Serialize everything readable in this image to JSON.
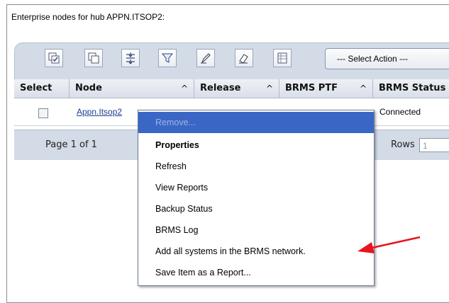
{
  "heading": "Enterprise nodes for hub APPN.ITSOP2:",
  "toolbar": {
    "buttons": [
      {
        "name": "select-all-icon"
      },
      {
        "name": "deselect-all-icon"
      },
      {
        "name": "expand-icon"
      },
      {
        "name": "filter-icon"
      },
      {
        "name": "edit-sort-icon"
      },
      {
        "name": "clear-filter-icon"
      },
      {
        "name": "table-icon"
      }
    ],
    "select_action": "--- Select Action ---"
  },
  "columns": {
    "select": "Select",
    "node": "Node",
    "release": "Release",
    "brms_ptf": "BRMS PTF",
    "brms_status": "BRMS Status",
    "sort_glyph": "^"
  },
  "rows": [
    {
      "node": "Appn.Itsop2",
      "status": "Connected"
    }
  ],
  "pager": {
    "page_text": "Page 1 of 1",
    "rows_label": "Rows",
    "rows_value": "1"
  },
  "context_menu": {
    "items": [
      {
        "label": "Remove...",
        "highlighted": true
      },
      {
        "label": "Properties",
        "bold": true
      },
      {
        "label": "Refresh"
      },
      {
        "label": "View Reports"
      },
      {
        "label": "Backup Status"
      },
      {
        "label": "BRMS Log"
      },
      {
        "label": "Add all systems in the BRMS network."
      },
      {
        "label": "Save Item as a Report..."
      }
    ]
  },
  "colors": {
    "highlight": "#3a67c6",
    "arrow": "#e8141e",
    "toolbar": "#d3dbe7"
  }
}
